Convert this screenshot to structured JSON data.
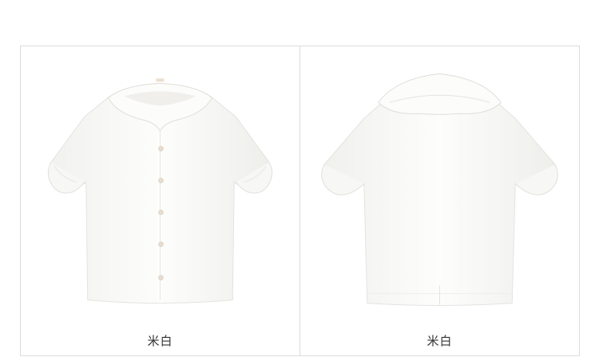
{
  "products": [
    {
      "view": "front",
      "color_label": "米白"
    },
    {
      "view": "back",
      "color_label": "米白"
    }
  ],
  "colors": {
    "garment": "#fbfbf9",
    "garment_shadow": "#e9e9e6",
    "button": "#e8ddd0",
    "border": "#dcdcdc",
    "caption_text": "#333333"
  }
}
